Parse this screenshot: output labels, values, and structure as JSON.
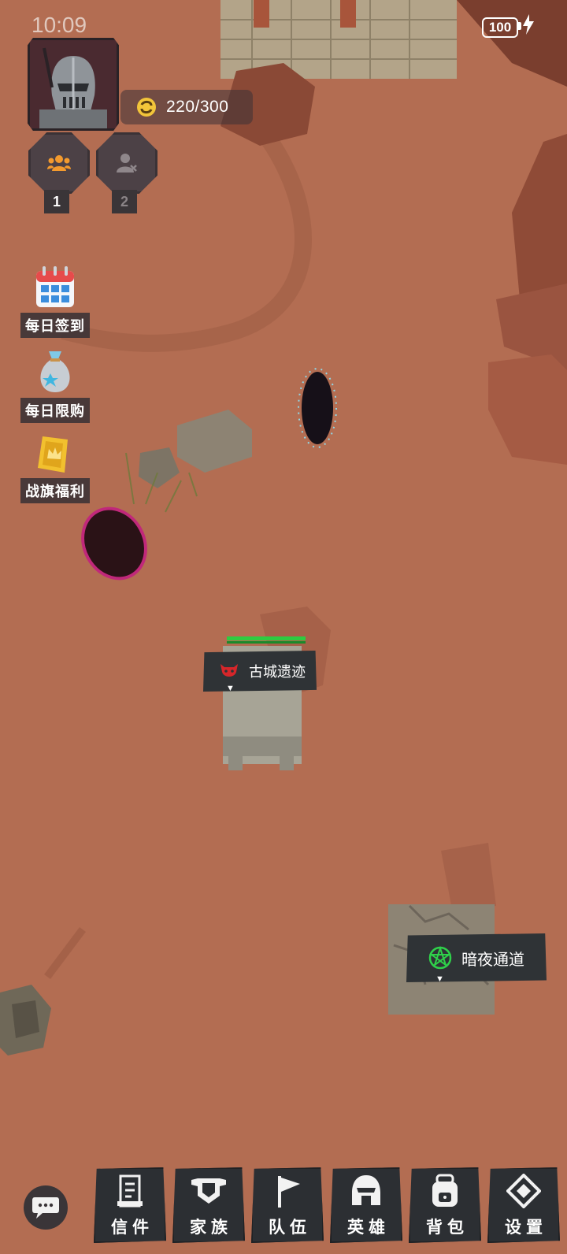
{
  "status_bar": {
    "time": "10:09",
    "battery": "100"
  },
  "player": {
    "avatar_icon": "knight-helmet-icon",
    "currency_icon": "coin-swirl-icon",
    "currency": "220/300"
  },
  "teams": [
    {
      "number": "1",
      "icon": "group-icon"
    },
    {
      "number": "2",
      "icon": "user-remove-icon"
    }
  ],
  "side_menu": [
    {
      "label": "每日签到",
      "icon": "calendar-icon"
    },
    {
      "label": "每日限购",
      "icon": "money-bag-icon"
    },
    {
      "label": "战旗福利",
      "icon": "golden-ticket-icon"
    }
  ],
  "world_labels": [
    {
      "name": "古城遗迹",
      "icon": "red-beast-icon"
    },
    {
      "name": "暗夜通道",
      "icon": "green-pentagram-icon"
    }
  ],
  "bottom_nav": [
    {
      "label": "信件",
      "icon": "scroll-icon"
    },
    {
      "label": "家族",
      "icon": "shield-banner-icon"
    },
    {
      "label": "队伍",
      "icon": "flag-icon"
    },
    {
      "label": "英雄",
      "icon": "spartan-helmet-icon"
    },
    {
      "label": "背包",
      "icon": "backpack-icon"
    },
    {
      "label": "设置",
      "icon": "diamond-settings-icon"
    }
  ],
  "chat": {
    "icon": "chat-bubble-icon"
  }
}
